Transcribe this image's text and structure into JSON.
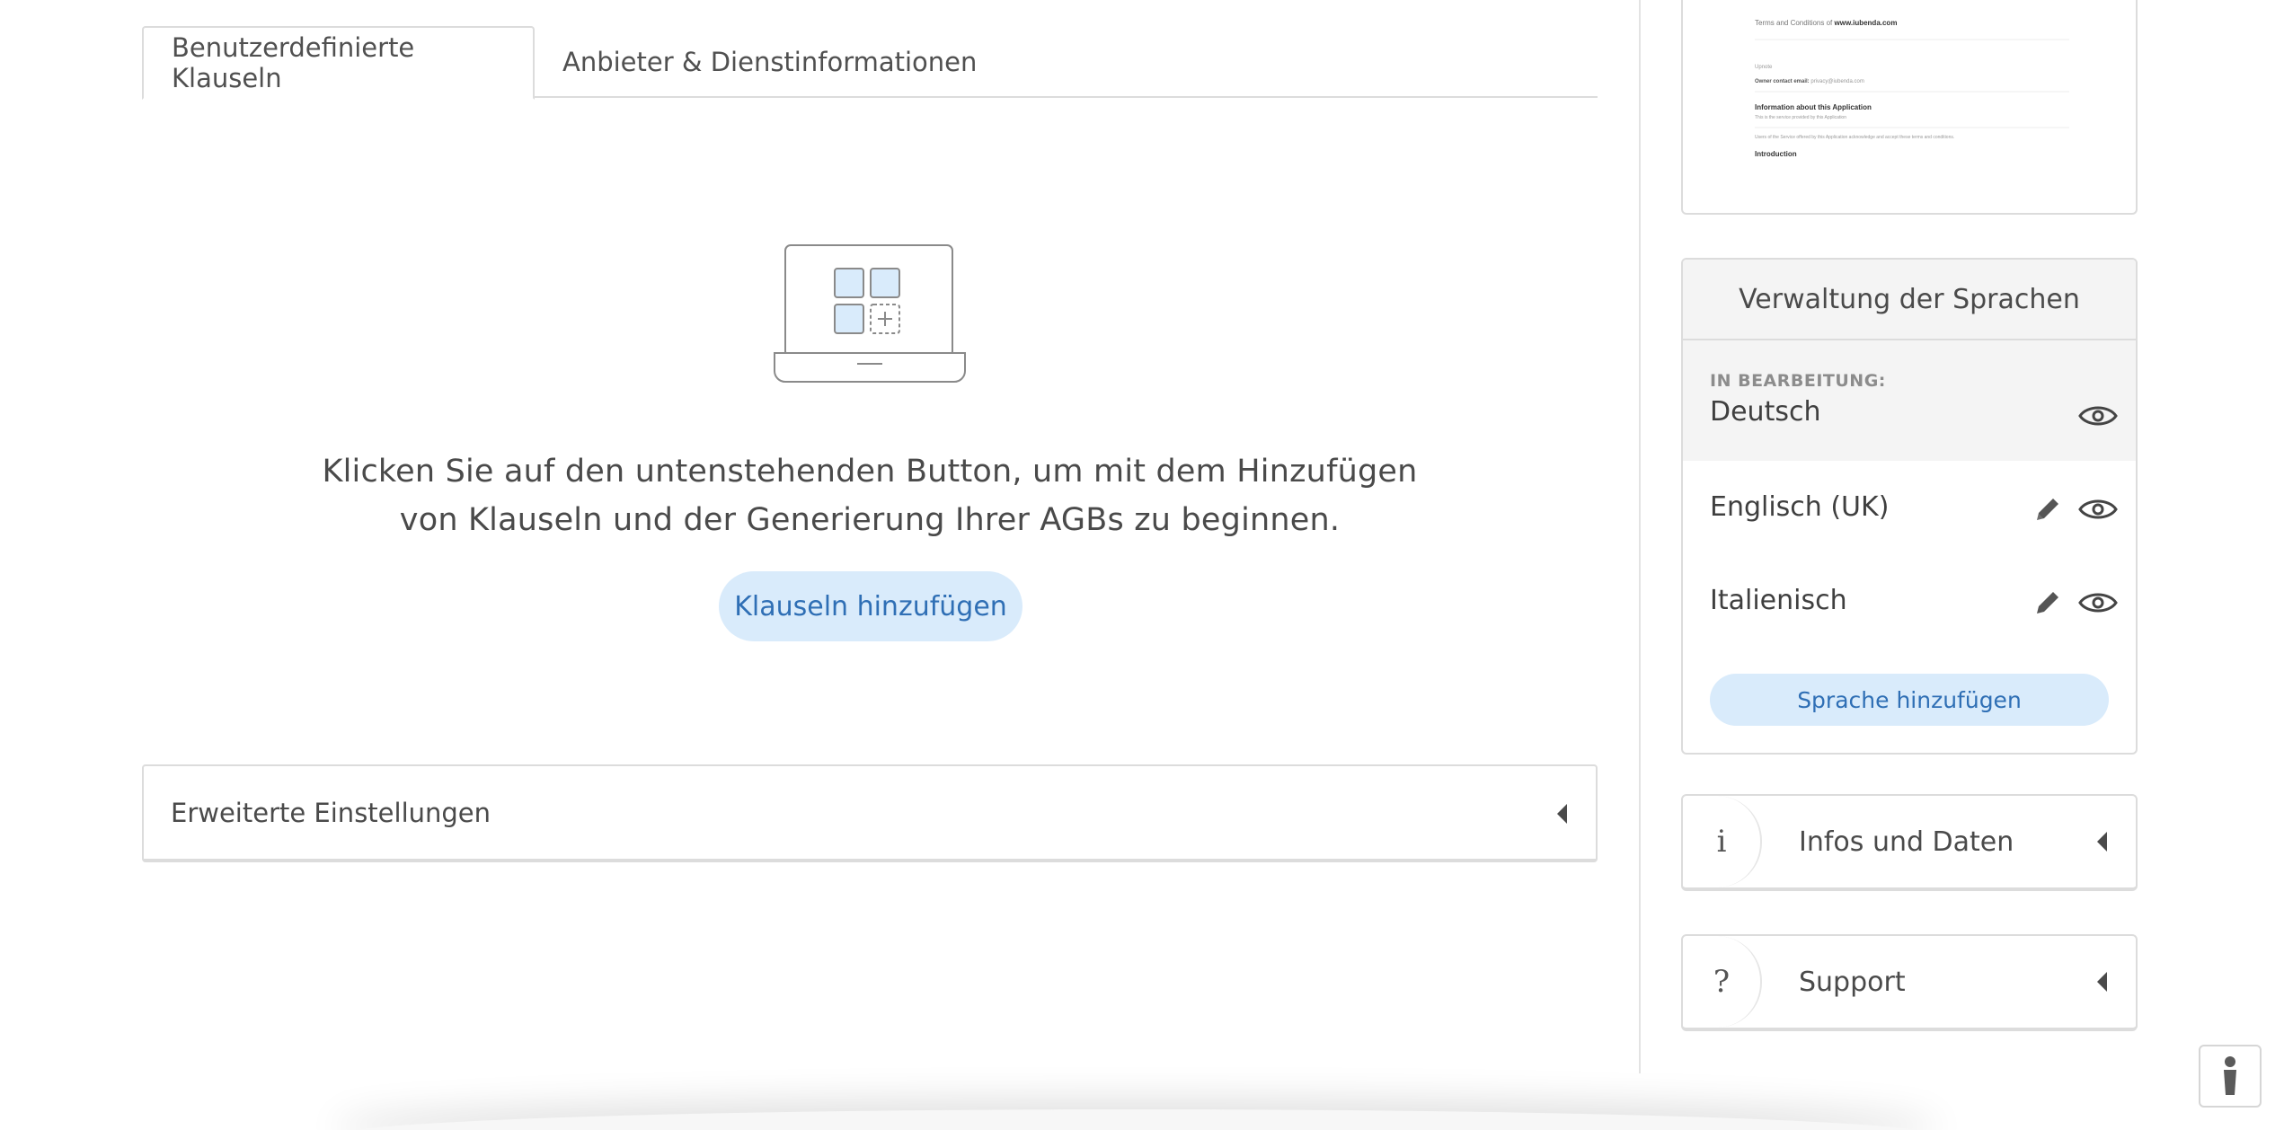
{
  "tabs": [
    {
      "label": "Benutzerdefinierte Klauseln",
      "active": true
    },
    {
      "label": "Anbieter & Dienstinformationen",
      "active": false
    }
  ],
  "empty_state": {
    "line1": "Klicken Sie auf den untenstehenden Button, um mit dem Hinzufügen",
    "line2": "von Klauseln und der Generierung Ihrer AGBs zu beginnen.",
    "button_label": "Klauseln hinzufügen"
  },
  "advanced_settings": {
    "label": "Erweiterte Einstellungen"
  },
  "preview": {
    "line1_prefix": "Terms and Conditions of",
    "line1_site": "www.iubenda.com",
    "line2": "Upnote",
    "line3_label": "Owner contact email:",
    "line3_value": "privacy@iubenda.com",
    "heading1": "Information about this Application",
    "line4": "This is the service provided by this Application",
    "line5": "Users of the Service offered by this Application acknowledge and accept these terms and conditions.",
    "heading2": "Introduction"
  },
  "languages": {
    "title": "Verwaltung der Sprachen",
    "editing_label": "IN BEARBEITUNG:",
    "current": "Deutsch",
    "others": [
      {
        "name": "Englisch (UK)"
      },
      {
        "name": "Italienisch"
      }
    ],
    "add_label": "Sprache hinzufügen"
  },
  "info_panel": {
    "badge": "i",
    "label": "Infos und Daten"
  },
  "support_panel": {
    "badge": "?",
    "label": "Support"
  },
  "colors": {
    "accent_bg": "#d9ebfb",
    "accent_text": "#2f6fb5",
    "border": "#dcdcdc"
  }
}
